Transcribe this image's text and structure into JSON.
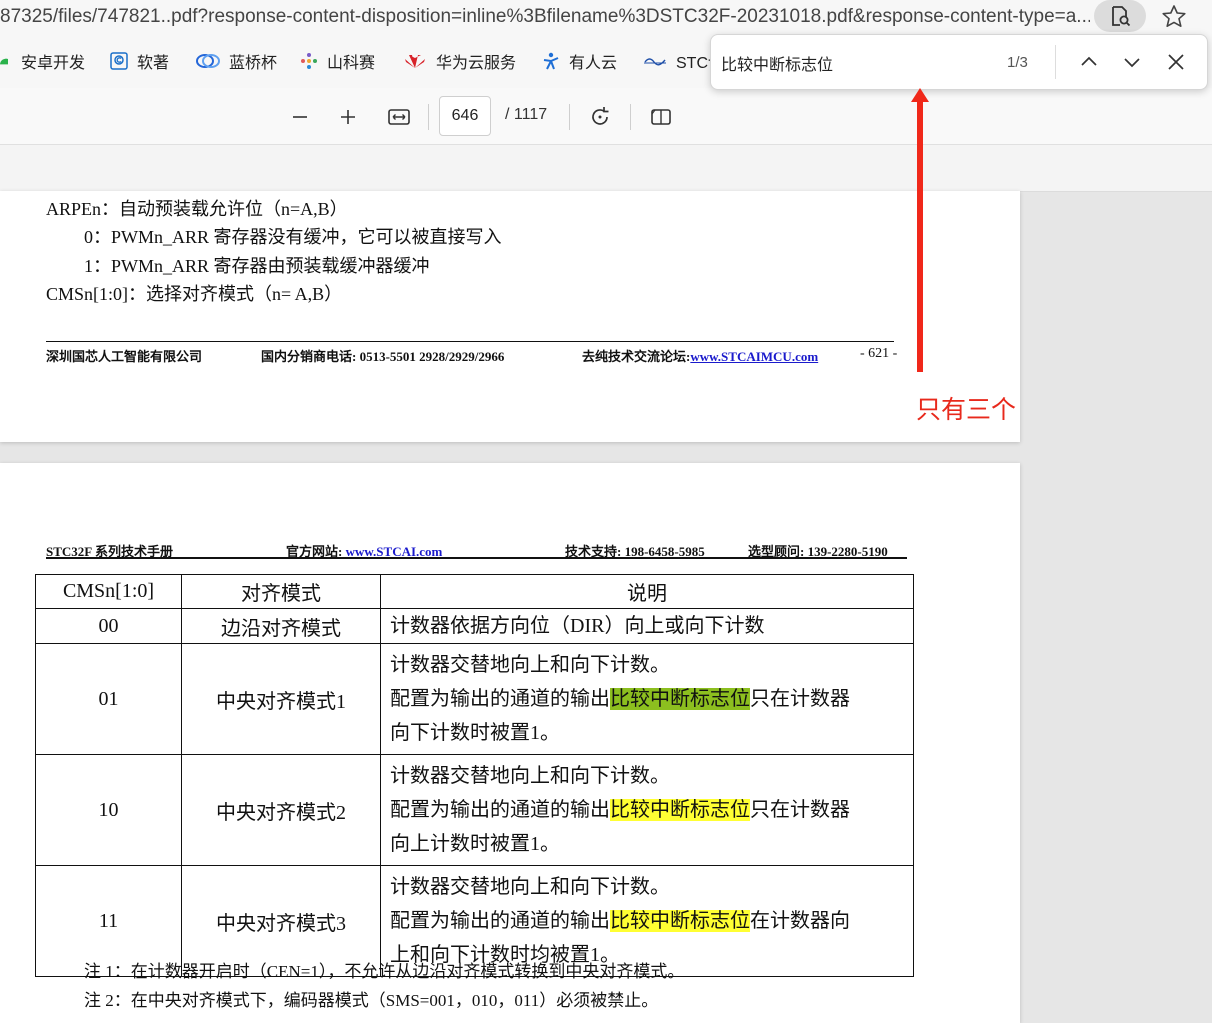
{
  "browser": {
    "url": "87325/files/747821..pdf?response-content-disposition=inline%3Bfilename%3DSTC32F-20231018.pdf&response-content-type=a...",
    "bookmarks": [
      {
        "label": "安卓开发",
        "color": "#2ab24b"
      },
      {
        "label": "软著",
        "color": "#1a6fc9"
      },
      {
        "label": "蓝桥杯",
        "color": "#2466d8"
      },
      {
        "label": "山科赛",
        "color": "#7a5cc8"
      },
      {
        "label": "华为云服务",
        "color": "#d8232a"
      },
      {
        "label": "有人云",
        "color": "#1f6fd6"
      },
      {
        "label": "STC讠",
        "color": "#1f4fa8"
      }
    ]
  },
  "find": {
    "query": "比较中断标志位",
    "count": "1/3"
  },
  "toolbar": {
    "page_number": "646",
    "page_total": "/ 1117"
  },
  "page1": {
    "lines": [
      "ARPEn：自动预装载允许位（n=A,B）",
      "0：PWMn_ARR 寄存器没有缓冲，它可以被直接写入",
      "1：PWMn_ARR 寄存器由预装载缓冲器缓冲",
      "CMSn[1:0]：选择对齐模式（n= A,B）"
    ],
    "footer": {
      "company": "深圳国芯人工智能有限公司",
      "phone_label": "国内分销商电话: 0513-5501 2928/2929/2966",
      "forum_label": "去纯技术交流论坛:",
      "forum_link": "www.STCAIMCU.com",
      "page_no": "- 621 -"
    }
  },
  "page2": {
    "header": {
      "manual": "STC32F 系列技术手册",
      "site_label": "官方网站:",
      "site_link": "www.STCAI.com",
      "support": "技术支持: 198-6458-5985",
      "consult": "选型顾问: 139-2280-5190"
    },
    "table": {
      "headers": [
        "CMSn[1:0]",
        "对齐模式",
        "说明"
      ],
      "row00": {
        "code": "00",
        "mode": "边沿对齐模式",
        "desc": "计数器依据方向位（DIR）向上或向下计数"
      },
      "row01": {
        "code": "01",
        "mode": "中央对齐模式1",
        "line1": "计数器交替地向上和向下计数。",
        "pre": "配置为输出的通道的输出",
        "hit": "比较中断标志位",
        "post": "只在计数器",
        "line3": "向下计数时被置1。"
      },
      "row10": {
        "code": "10",
        "mode": "中央对齐模式2",
        "line1": "计数器交替地向上和向下计数。",
        "pre": "配置为输出的通道的输出",
        "hit": "比较中断标志位",
        "post": "只在计数器",
        "line3": "向上计数时被置1。"
      },
      "row11": {
        "code": "11",
        "mode": "中央对齐模式3",
        "line1": "计数器交替地向上和向下计数。",
        "pre": "配置为输出的通道的输出",
        "hit": "比较中断标志位",
        "post": "在计数器向",
        "line3": "上和向下计数时均被置1。"
      }
    },
    "notes": [
      "注 1：在计数器开启时（CEN=1），不允许从边沿对齐模式转换到中央对齐模式。",
      "注 2：在中央对齐模式下，编码器模式（SMS=001，010，011）必须被禁止。"
    ]
  },
  "annotation": {
    "text": "只有三个",
    "color": "#e8291c"
  }
}
